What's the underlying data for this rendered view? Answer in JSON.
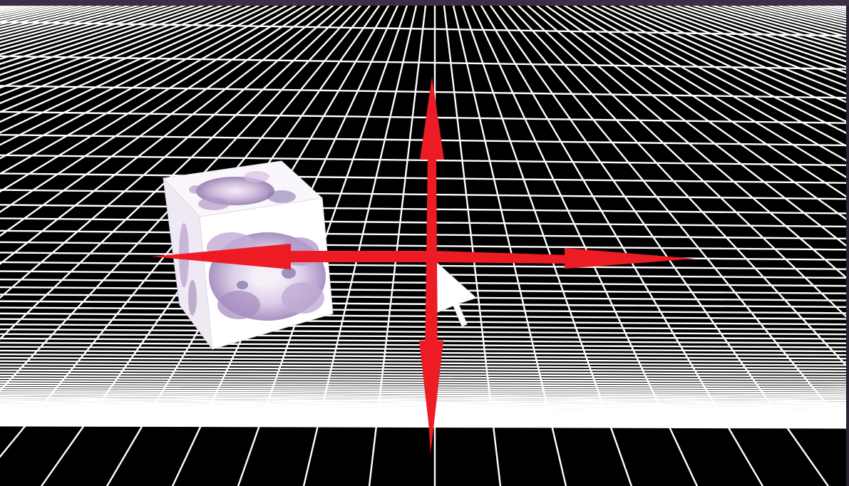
{
  "scene": {
    "objects": [
      {
        "kind": "textured-cube",
        "texture": "anime-character-illustration"
      },
      {
        "kind": "move-gizmo",
        "axes": [
          "x",
          "y"
        ]
      },
      {
        "kind": "mouse-cursor"
      }
    ],
    "floor": "wireframe-grid"
  },
  "colors": {
    "background": "#000000",
    "grid": "#ffffff",
    "gizmo": "#ed1c24",
    "window_frame": "#3b2f45"
  }
}
